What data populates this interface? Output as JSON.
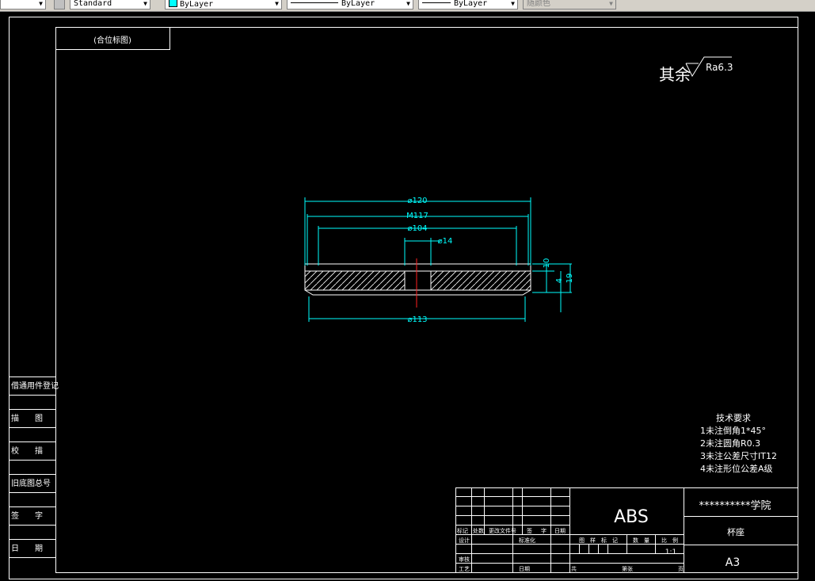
{
  "toolbar": {
    "text_style": "Standard",
    "color": "ByLayer",
    "linetype": "ByLayer",
    "lineweight": "ByLayer",
    "plot_style": "随颜色"
  },
  "drawing": {
    "corner_label": "(合位标图)",
    "roughness_prefix": "其余",
    "roughness_value": "Ra6.3",
    "dims": {
      "d120": "⌀120",
      "m117": "M117",
      "d104": "⌀104",
      "d14": "⌀14",
      "d113": "⌀113",
      "v10": "10",
      "v4": "4",
      "v19": "19"
    },
    "tech": {
      "title": "技术要求",
      "items": [
        "1未注倒角1*45°",
        "2未注圆角R0.3",
        "3未注公差尺寸IT12",
        "4未注形位公差A级"
      ]
    },
    "side_labels": [
      "借通用件登记",
      "描　　图",
      "校　　描",
      "旧底图总号",
      "签　　字",
      "日　　期"
    ],
    "title_block": {
      "material": "ABS",
      "school": "**********学院",
      "part_name": "杯座",
      "sheet_size": "A3",
      "scale": "1:1",
      "rev_headers": [
        "标记",
        "处数",
        "更改文件号",
        "签",
        "字",
        "日期"
      ],
      "left_rows": [
        "设计",
        "审核",
        "工艺"
      ],
      "std_label": "标准化",
      "date_label": "日期",
      "mid_headers": [
        "图",
        "样",
        "标",
        "记",
        "数",
        "量",
        "比",
        "例"
      ],
      "sheet_label": "共",
      "sheet_label2": "第张",
      "page_label": "页"
    }
  }
}
